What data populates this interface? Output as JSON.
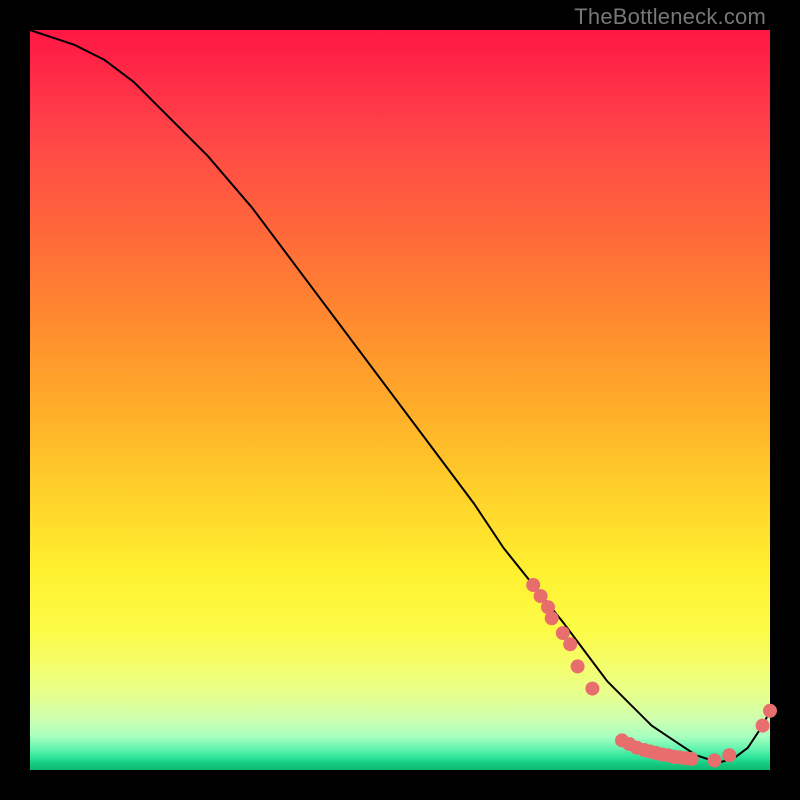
{
  "watermark": "TheBottleneck.com",
  "chart_data": {
    "type": "line",
    "title": "",
    "xlabel": "",
    "ylabel": "",
    "xlim": [
      0,
      100
    ],
    "ylim": [
      0,
      100
    ],
    "grid": false,
    "legend": false,
    "series": [
      {
        "name": "bottleneck-curve",
        "x": [
          0,
          3,
          6,
          10,
          14,
          18,
          24,
          30,
          36,
          42,
          48,
          54,
          60,
          64,
          68,
          72,
          75,
          78,
          81,
          84,
          87,
          90,
          93,
          95,
          97,
          99,
          100
        ],
        "y": [
          100,
          99,
          98,
          96,
          93,
          89,
          83,
          76,
          68,
          60,
          52,
          44,
          36,
          30,
          25,
          20,
          16,
          12,
          9,
          6,
          4,
          2,
          1,
          1.5,
          3,
          6,
          8
        ]
      }
    ],
    "scatter_points": {
      "name": "highlighted-points",
      "points": [
        {
          "x": 68,
          "y": 25
        },
        {
          "x": 69,
          "y": 23.5
        },
        {
          "x": 70,
          "y": 22
        },
        {
          "x": 70.5,
          "y": 20.5
        },
        {
          "x": 72,
          "y": 18.5
        },
        {
          "x": 73,
          "y": 17
        },
        {
          "x": 74,
          "y": 14
        },
        {
          "x": 76,
          "y": 11
        },
        {
          "x": 80,
          "y": 4
        },
        {
          "x": 81,
          "y": 3.5
        },
        {
          "x": 82,
          "y": 3
        },
        {
          "x": 83,
          "y": 2.7
        },
        {
          "x": 83.8,
          "y": 2.5
        },
        {
          "x": 84.6,
          "y": 2.3
        },
        {
          "x": 85.4,
          "y": 2.1
        },
        {
          "x": 86.2,
          "y": 2
        },
        {
          "x": 87,
          "y": 1.8
        },
        {
          "x": 87.8,
          "y": 1.7
        },
        {
          "x": 88.6,
          "y": 1.6
        },
        {
          "x": 89.4,
          "y": 1.5
        },
        {
          "x": 92.5,
          "y": 1.3
        },
        {
          "x": 94.5,
          "y": 2
        },
        {
          "x": 99,
          "y": 6
        },
        {
          "x": 100,
          "y": 8
        }
      ]
    },
    "dot_radius_px": 7
  },
  "colors": {
    "dot": "#e86d6d",
    "curve": "#000000",
    "frame": "#000000",
    "watermark": "#777777"
  }
}
